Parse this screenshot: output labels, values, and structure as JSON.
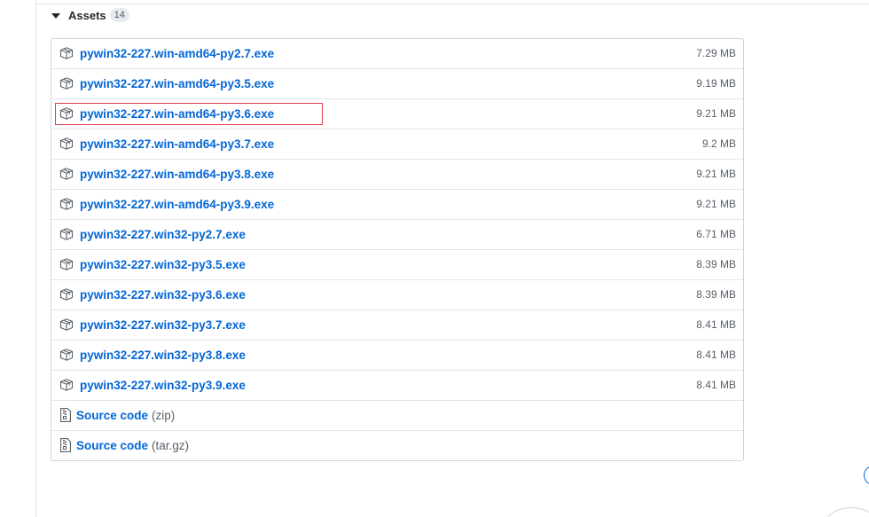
{
  "assets": {
    "title": "Assets",
    "count": "14",
    "files": [
      {
        "name": "pywin32-227.win-amd64-py2.7.exe",
        "size": "7.29 MB"
      },
      {
        "name": "pywin32-227.win-amd64-py3.5.exe",
        "size": "9.19 MB"
      },
      {
        "name": "pywin32-227.win-amd64-py3.6.exe",
        "size": "9.21 MB",
        "highlighted": true
      },
      {
        "name": "pywin32-227.win-amd64-py3.7.exe",
        "size": "9.2 MB"
      },
      {
        "name": "pywin32-227.win-amd64-py3.8.exe",
        "size": "9.21 MB"
      },
      {
        "name": "pywin32-227.win-amd64-py3.9.exe",
        "size": "9.21 MB"
      },
      {
        "name": "pywin32-227.win32-py2.7.exe",
        "size": "6.71 MB"
      },
      {
        "name": "pywin32-227.win32-py3.5.exe",
        "size": "8.39 MB"
      },
      {
        "name": "pywin32-227.win32-py3.6.exe",
        "size": "8.39 MB"
      },
      {
        "name": "pywin32-227.win32-py3.7.exe",
        "size": "8.41 MB"
      },
      {
        "name": "pywin32-227.win32-py3.8.exe",
        "size": "8.41 MB"
      },
      {
        "name": "pywin32-227.win32-py3.9.exe",
        "size": "8.41 MB"
      }
    ],
    "source_code": [
      {
        "label": "Source code",
        "format": "(zip)"
      },
      {
        "label": "Source code",
        "format": "(tar.gz)"
      }
    ]
  },
  "icons": {
    "package": "package-icon",
    "file_zip": "file-zip-icon",
    "caret": "triangle-down-icon"
  },
  "colors": {
    "link": "#0366d6",
    "highlight_border": "#e0404a",
    "muted_text": "#586069",
    "border": "#d1d5da"
  }
}
